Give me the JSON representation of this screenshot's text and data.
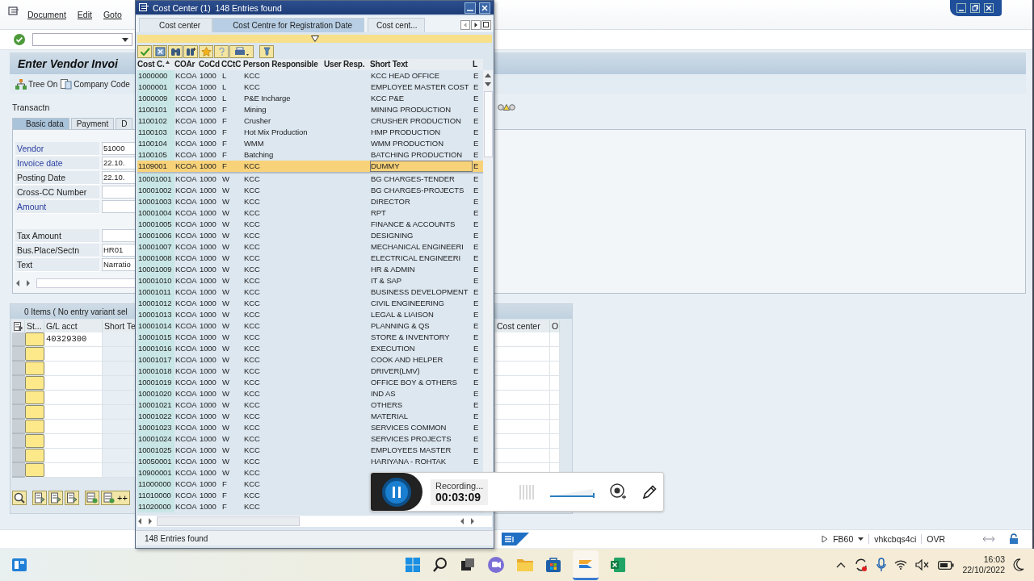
{
  "main_window": {
    "menu": [
      "Document",
      "Edit",
      "Goto"
    ],
    "title": "Enter Vendor Invoi",
    "app_toolbar": [
      "Tree On",
      "Company Code"
    ],
    "transaction_label": "Transactn",
    "tabs": [
      {
        "label": "Basic data",
        "selected": true
      },
      {
        "label": "Payment",
        "selected": false
      },
      {
        "label": "D",
        "selected": false
      }
    ],
    "fields": [
      {
        "label": "Vendor",
        "highlighted": true,
        "value": "51000"
      },
      {
        "label": "Invoice date",
        "highlighted": true,
        "value": "22.10."
      },
      {
        "label": "Posting Date",
        "highlighted": false,
        "value": "22.10."
      },
      {
        "label": "Cross-CC Number",
        "highlighted": false
      },
      {
        "label": "Amount",
        "highlighted": true
      },
      {
        "label": "Tax Amount",
        "highlighted": false,
        "gap_before": true
      },
      {
        "label": "Bus.Place/Sectn",
        "highlighted": false,
        "value": "HR01"
      },
      {
        "label": "Text",
        "highlighted": false,
        "value": "Narratio"
      }
    ],
    "items_table": {
      "title": "0 Items ( No entry variant sel",
      "columns": [
        "St...",
        "G/L acct",
        "Short Te"
      ],
      "right_columns": [
        "Cost center",
        "O"
      ],
      "rows": [
        {
          "gl_acct": "40329300"
        }
      ]
    },
    "add_label": "++",
    "status_bar": {
      "transaction": "FB60",
      "server": "vhkcbqs4ci",
      "mode": "OVR"
    }
  },
  "popup": {
    "title": "Cost Center (1)  148 Entries found",
    "tabs": [
      {
        "label": "Cost center",
        "selected": false
      },
      {
        "label": "Cost Centre for Registration Date",
        "selected": true
      },
      {
        "label": "Cost cent...",
        "selected": false
      }
    ],
    "columns": [
      "Cost C.",
      "COAr",
      "CoCd",
      "CCtC",
      "Person Responsible",
      "User Resp.",
      "Short Text",
      "L"
    ],
    "rows": [
      {
        "cost_center": "1000000",
        "co_area": "KCOA",
        "company_code": "1000",
        "category": "L",
        "person": "KCC",
        "short_text": "KCC HEAD OFFICE",
        "lang": "E",
        "selected": false
      },
      {
        "cost_center": "1000001",
        "co_area": "KCOA",
        "company_code": "1000",
        "category": "L",
        "person": "KCC",
        "short_text": "EMPLOYEE MASTER COST",
        "lang": "E",
        "selected": false
      },
      {
        "cost_center": "1000009",
        "co_area": "KCOA",
        "company_code": "1000",
        "category": "L",
        "person": "P&E Incharge",
        "short_text": "KCC P&E",
        "lang": "E",
        "selected": false
      },
      {
        "cost_center": "1100101",
        "co_area": "KCOA",
        "company_code": "1000",
        "category": "F",
        "person": "Mining",
        "short_text": "MINING PRODUCTION",
        "lang": "E",
        "selected": false
      },
      {
        "cost_center": "1100102",
        "co_area": "KCOA",
        "company_code": "1000",
        "category": "F",
        "person": "Crusher",
        "short_text": "CRUSHER PRODUCTION",
        "lang": "E",
        "selected": false
      },
      {
        "cost_center": "1100103",
        "co_area": "KCOA",
        "company_code": "1000",
        "category": "F",
        "person": "Hot Mix Production",
        "short_text": "HMP PRODUCTION",
        "lang": "E",
        "selected": false
      },
      {
        "cost_center": "1100104",
        "co_area": "KCOA",
        "company_code": "1000",
        "category": "F",
        "person": "WMM",
        "short_text": "WMM PRODUCTION",
        "lang": "E",
        "selected": false
      },
      {
        "cost_center": "1100105",
        "co_area": "KCOA",
        "company_code": "1000",
        "category": "F",
        "person": "Batching",
        "short_text": "BATCHING PRODUCTION",
        "lang": "E",
        "selected": false
      },
      {
        "cost_center": "1109001",
        "co_area": "KCOA",
        "company_code": "1000",
        "category": "F",
        "person": "KCC",
        "short_text": "DUMMY",
        "lang": "E",
        "selected": true
      },
      {
        "cost_center": "10001001",
        "co_area": "KCOA",
        "company_code": "1000",
        "category": "W",
        "person": "KCC",
        "short_text": "BG CHARGES-TENDER",
        "lang": "E",
        "selected": false
      },
      {
        "cost_center": "10001002",
        "co_area": "KCOA",
        "company_code": "1000",
        "category": "W",
        "person": "KCC",
        "short_text": "BG CHARGES-PROJECTS",
        "lang": "E",
        "selected": false
      },
      {
        "cost_center": "10001003",
        "co_area": "KCOA",
        "company_code": "1000",
        "category": "W",
        "person": "KCC",
        "short_text": "DIRECTOR",
        "lang": "E",
        "selected": false
      },
      {
        "cost_center": "10001004",
        "co_area": "KCOA",
        "company_code": "1000",
        "category": "W",
        "person": "KCC",
        "short_text": "RPT",
        "lang": "E",
        "selected": false
      },
      {
        "cost_center": "10001005",
        "co_area": "KCOA",
        "company_code": "1000",
        "category": "W",
        "person": "KCC",
        "short_text": "FINANCE & ACCOUNTS",
        "lang": "E",
        "selected": false
      },
      {
        "cost_center": "10001006",
        "co_area": "KCOA",
        "company_code": "1000",
        "category": "W",
        "person": "KCC",
        "short_text": "DESIGNING",
        "lang": "E",
        "selected": false
      },
      {
        "cost_center": "10001007",
        "co_area": "KCOA",
        "company_code": "1000",
        "category": "W",
        "person": "KCC",
        "short_text": "MECHANICAL ENGINEERI",
        "lang": "E",
        "selected": false
      },
      {
        "cost_center": "10001008",
        "co_area": "KCOA",
        "company_code": "1000",
        "category": "W",
        "person": "KCC",
        "short_text": "ELECTRICAL ENGINEERI",
        "lang": "E",
        "selected": false
      },
      {
        "cost_center": "10001009",
        "co_area": "KCOA",
        "company_code": "1000",
        "category": "W",
        "person": "KCC",
        "short_text": "HR & ADMIN",
        "lang": "E",
        "selected": false
      },
      {
        "cost_center": "10001010",
        "co_area": "KCOA",
        "company_code": "1000",
        "category": "W",
        "person": "KCC",
        "short_text": "IT & SAP",
        "lang": "E",
        "selected": false
      },
      {
        "cost_center": "10001011",
        "co_area": "KCOA",
        "company_code": "1000",
        "category": "W",
        "person": "KCC",
        "short_text": "BUSINESS DEVELOPMENT",
        "lang": "E",
        "selected": false
      },
      {
        "cost_center": "10001012",
        "co_area": "KCOA",
        "company_code": "1000",
        "category": "W",
        "person": "KCC",
        "short_text": "CIVIL ENGINEERING",
        "lang": "E",
        "selected": false
      },
      {
        "cost_center": "10001013",
        "co_area": "KCOA",
        "company_code": "1000",
        "category": "W",
        "person": "KCC",
        "short_text": "LEGAL & LIAISON",
        "lang": "E",
        "selected": false
      },
      {
        "cost_center": "10001014",
        "co_area": "KCOA",
        "company_code": "1000",
        "category": "W",
        "person": "KCC",
        "short_text": "PLANNING & QS",
        "lang": "E",
        "selected": false
      },
      {
        "cost_center": "10001015",
        "co_area": "KCOA",
        "company_code": "1000",
        "category": "W",
        "person": "KCC",
        "short_text": "STORE & INVENTORY",
        "lang": "E",
        "selected": false
      },
      {
        "cost_center": "10001016",
        "co_area": "KCOA",
        "company_code": "1000",
        "category": "W",
        "person": "KCC",
        "short_text": "EXECUTION",
        "lang": "E",
        "selected": false
      },
      {
        "cost_center": "10001017",
        "co_area": "KCOA",
        "company_code": "1000",
        "category": "W",
        "person": "KCC",
        "short_text": "COOK AND HELPER",
        "lang": "E",
        "selected": false
      },
      {
        "cost_center": "10001018",
        "co_area": "KCOA",
        "company_code": "1000",
        "category": "W",
        "person": "KCC",
        "short_text": "DRIVER(LMV)",
        "lang": "E",
        "selected": false
      },
      {
        "cost_center": "10001019",
        "co_area": "KCOA",
        "company_code": "1000",
        "category": "W",
        "person": "KCC",
        "short_text": "OFFICE BOY & OTHERS",
        "lang": "E",
        "selected": false
      },
      {
        "cost_center": "10001020",
        "co_area": "KCOA",
        "company_code": "1000",
        "category": "W",
        "person": "KCC",
        "short_text": "IND AS",
        "lang": "E",
        "selected": false
      },
      {
        "cost_center": "10001021",
        "co_area": "KCOA",
        "company_code": "1000",
        "category": "W",
        "person": "KCC",
        "short_text": "OTHERS",
        "lang": "E",
        "selected": false
      },
      {
        "cost_center": "10001022",
        "co_area": "KCOA",
        "company_code": "1000",
        "category": "W",
        "person": "KCC",
        "short_text": "MATERIAL",
        "lang": "E",
        "selected": false
      },
      {
        "cost_center": "10001023",
        "co_area": "KCOA",
        "company_code": "1000",
        "category": "W",
        "person": "KCC",
        "short_text": "SERVICES COMMON",
        "lang": "E",
        "selected": false
      },
      {
        "cost_center": "10001024",
        "co_area": "KCOA",
        "company_code": "1000",
        "category": "W",
        "person": "KCC",
        "short_text": "SERVICES PROJECTS",
        "lang": "E",
        "selected": false
      },
      {
        "cost_center": "10001025",
        "co_area": "KCOA",
        "company_code": "1000",
        "category": "W",
        "person": "KCC",
        "short_text": "EMPLOYEES MASTER",
        "lang": "E",
        "selected": false
      },
      {
        "cost_center": "10050001",
        "co_area": "KCOA",
        "company_code": "1000",
        "category": "W",
        "person": "KCC",
        "short_text": "HARIYANA - ROHTAK",
        "lang": "E",
        "selected": false
      },
      {
        "cost_center": "10900001",
        "co_area": "KCOA",
        "company_code": "1000",
        "category": "W",
        "person": "KCC",
        "selected": false
      },
      {
        "cost_center": "11000000",
        "co_area": "KCOA",
        "company_code": "1000",
        "category": "F",
        "person": "KCC",
        "selected": false
      },
      {
        "cost_center": "11010000",
        "co_area": "KCOA",
        "company_code": "1000",
        "category": "F",
        "person": "KCC",
        "selected": false
      },
      {
        "cost_center": "11020000",
        "co_area": "KCOA",
        "company_code": "1000",
        "category": "F",
        "person": "KCC",
        "selected": false
      }
    ],
    "status": "148 Entries found"
  },
  "recording": {
    "status": "Recording...",
    "time": "00:03:09"
  },
  "taskbar": {
    "time": "16:03",
    "date": "22/10/2022"
  }
}
